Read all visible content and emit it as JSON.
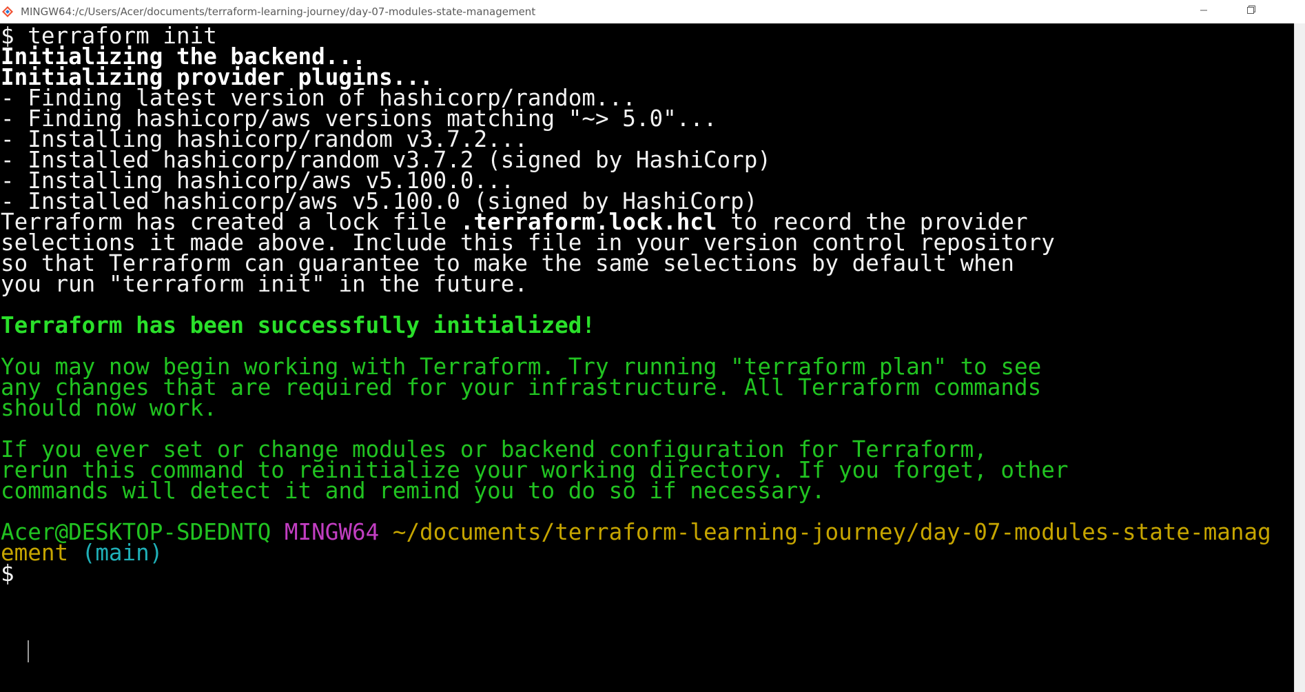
{
  "window": {
    "title": "MINGW64:/c/Users/Acer/documents/terraform-learning-journey/day-07-modules-state-management",
    "icon": "git-bash-icon",
    "controls": {
      "minimize": "minimize-icon",
      "restore": "restore-icon"
    }
  },
  "colors": {
    "background": "#000000",
    "text": "#f2f2f2",
    "success": "#2ae02a",
    "info_green": "#21c321",
    "prompt_system": "#c23ec2",
    "prompt_path": "#c6a500",
    "prompt_branch": "#1fb0b8"
  },
  "terminal": {
    "command_line": "$ terraform init",
    "init_backend": "Initializing the backend...",
    "init_plugins": "Initializing provider plugins...",
    "plugin_lines": [
      "- Finding latest version of hashicorp/random...",
      "- Finding hashicorp/aws versions matching \"~> 5.0\"...",
      "- Installing hashicorp/random v3.7.2...",
      "- Installed hashicorp/random v3.7.2 (signed by HashiCorp)",
      "- Installing hashicorp/aws v5.100.0...",
      "- Installed hashicorp/aws v5.100.0 (signed by HashiCorp)"
    ],
    "lock_prefix": "Terraform has created a lock file ",
    "lock_file": ".terraform.lock.hcl",
    "lock_suffix": " to record the provider",
    "lock_lines": [
      "selections it made above. Include this file in your version control repository",
      "so that Terraform can guarantee to make the same selections by default when",
      "you run \"terraform init\" in the future."
    ],
    "success_message": "Terraform has been successfully initialized!",
    "next_steps": [
      "You may now begin working with Terraform. Try running \"terraform plan\" to see",
      "any changes that are required for your infrastructure. All Terraform commands",
      "should now work."
    ],
    "rerun_notes": [
      "If you ever set or change modules or backend configuration for Terraform,",
      "rerun this command to reinitialize your working directory. If you forget, other",
      "commands will detect it and remind you to do so if necessary."
    ],
    "prompt": {
      "user_host": "Acer@DESKTOP-SDEDNTQ",
      "system": "MINGW64",
      "path_part1": "~/documents/terraform-learning-journey/day-07-modules-state-manag",
      "path_part2": "ement",
      "branch": "(main)",
      "symbol": "$"
    }
  }
}
